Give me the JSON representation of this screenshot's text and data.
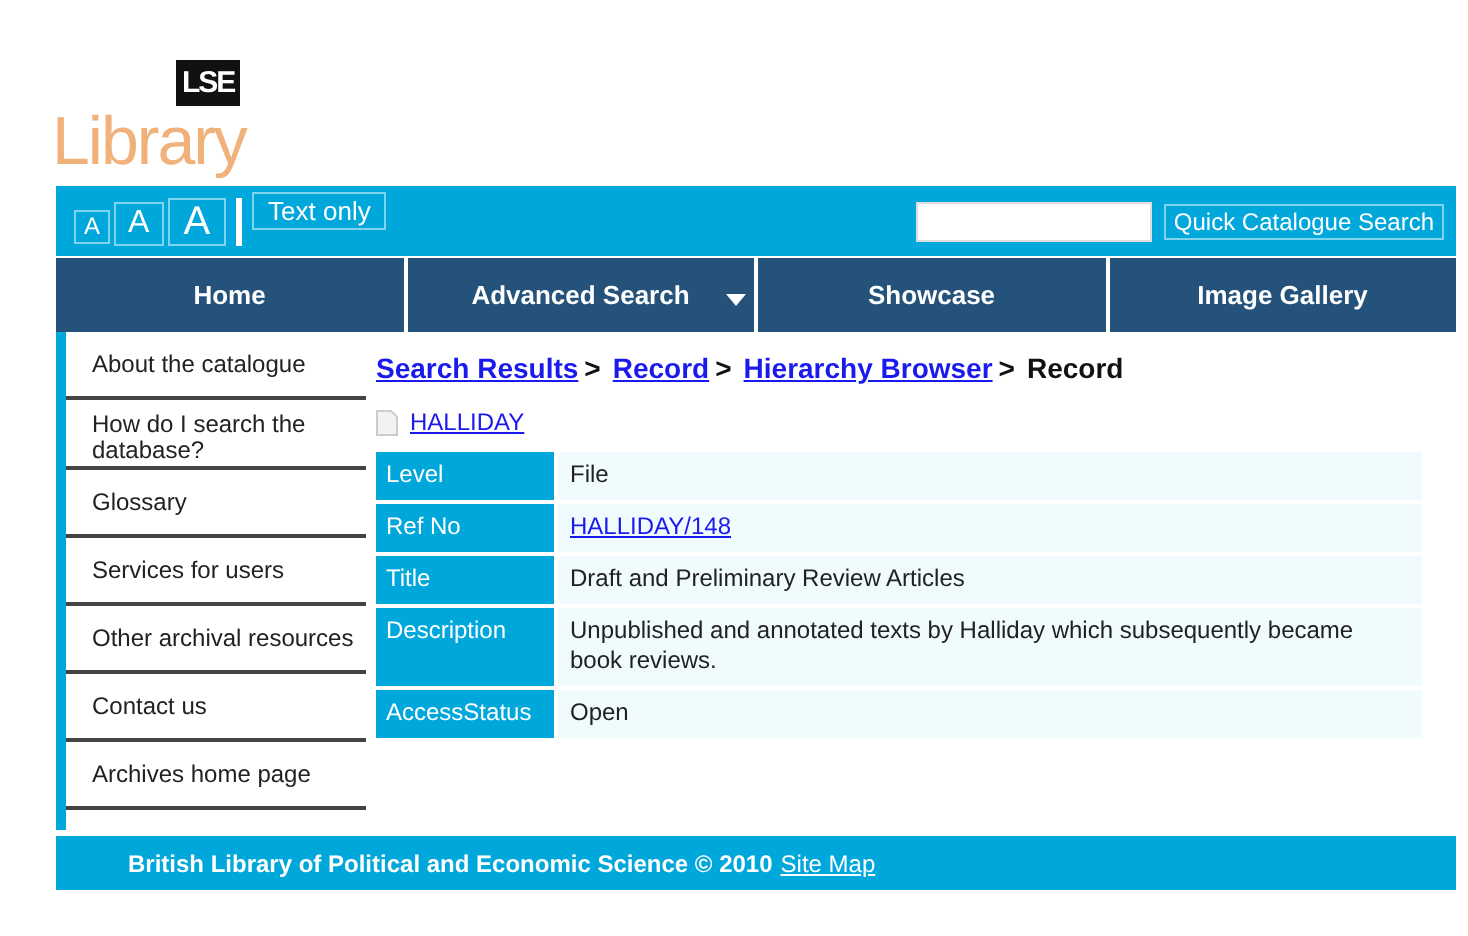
{
  "logo": {
    "badge": "LSE",
    "wordmark": "Library"
  },
  "toolbar": {
    "font_sizes": [
      "A",
      "A",
      "A"
    ],
    "text_only": "Text only",
    "search_button": "Quick Catalogue Search"
  },
  "nav": [
    {
      "label": "Home",
      "dropdown": false
    },
    {
      "label": "Advanced Search",
      "dropdown": true
    },
    {
      "label": "Showcase",
      "dropdown": false
    },
    {
      "label": "Image Gallery",
      "dropdown": false
    }
  ],
  "sidebar": {
    "items": [
      "About the catalogue",
      "How do I search the database?",
      "Glossary",
      "Services for users",
      "Other archival resources",
      "Contact us",
      "Archives home page"
    ]
  },
  "breadcrumb": [
    {
      "label": "Search Results",
      "kind": "link",
      "separator": ">"
    },
    {
      "label": "Record",
      "kind": "link",
      "separator": ">"
    },
    {
      "label": "Hierarchy Browser",
      "kind": "link",
      "separator": ">"
    },
    {
      "label": "Record",
      "kind": "current"
    }
  ],
  "parent_link": "HALLIDAY",
  "record": [
    {
      "field": "Level",
      "value": "File",
      "kind": "text"
    },
    {
      "field": "Ref No",
      "value": "HALLIDAY/148",
      "kind": "link"
    },
    {
      "field": "Title",
      "value": "Draft and Preliminary Review Articles",
      "kind": "text"
    },
    {
      "field": "Description",
      "value": "Unpublished and annotated texts by Halliday which subsequently became book reviews.",
      "kind": "text"
    },
    {
      "field": "AccessStatus",
      "value": "Open",
      "kind": "text"
    }
  ],
  "footer": {
    "text": "British Library of Political and Economic Science © 2010",
    "link": "Site Map"
  }
}
